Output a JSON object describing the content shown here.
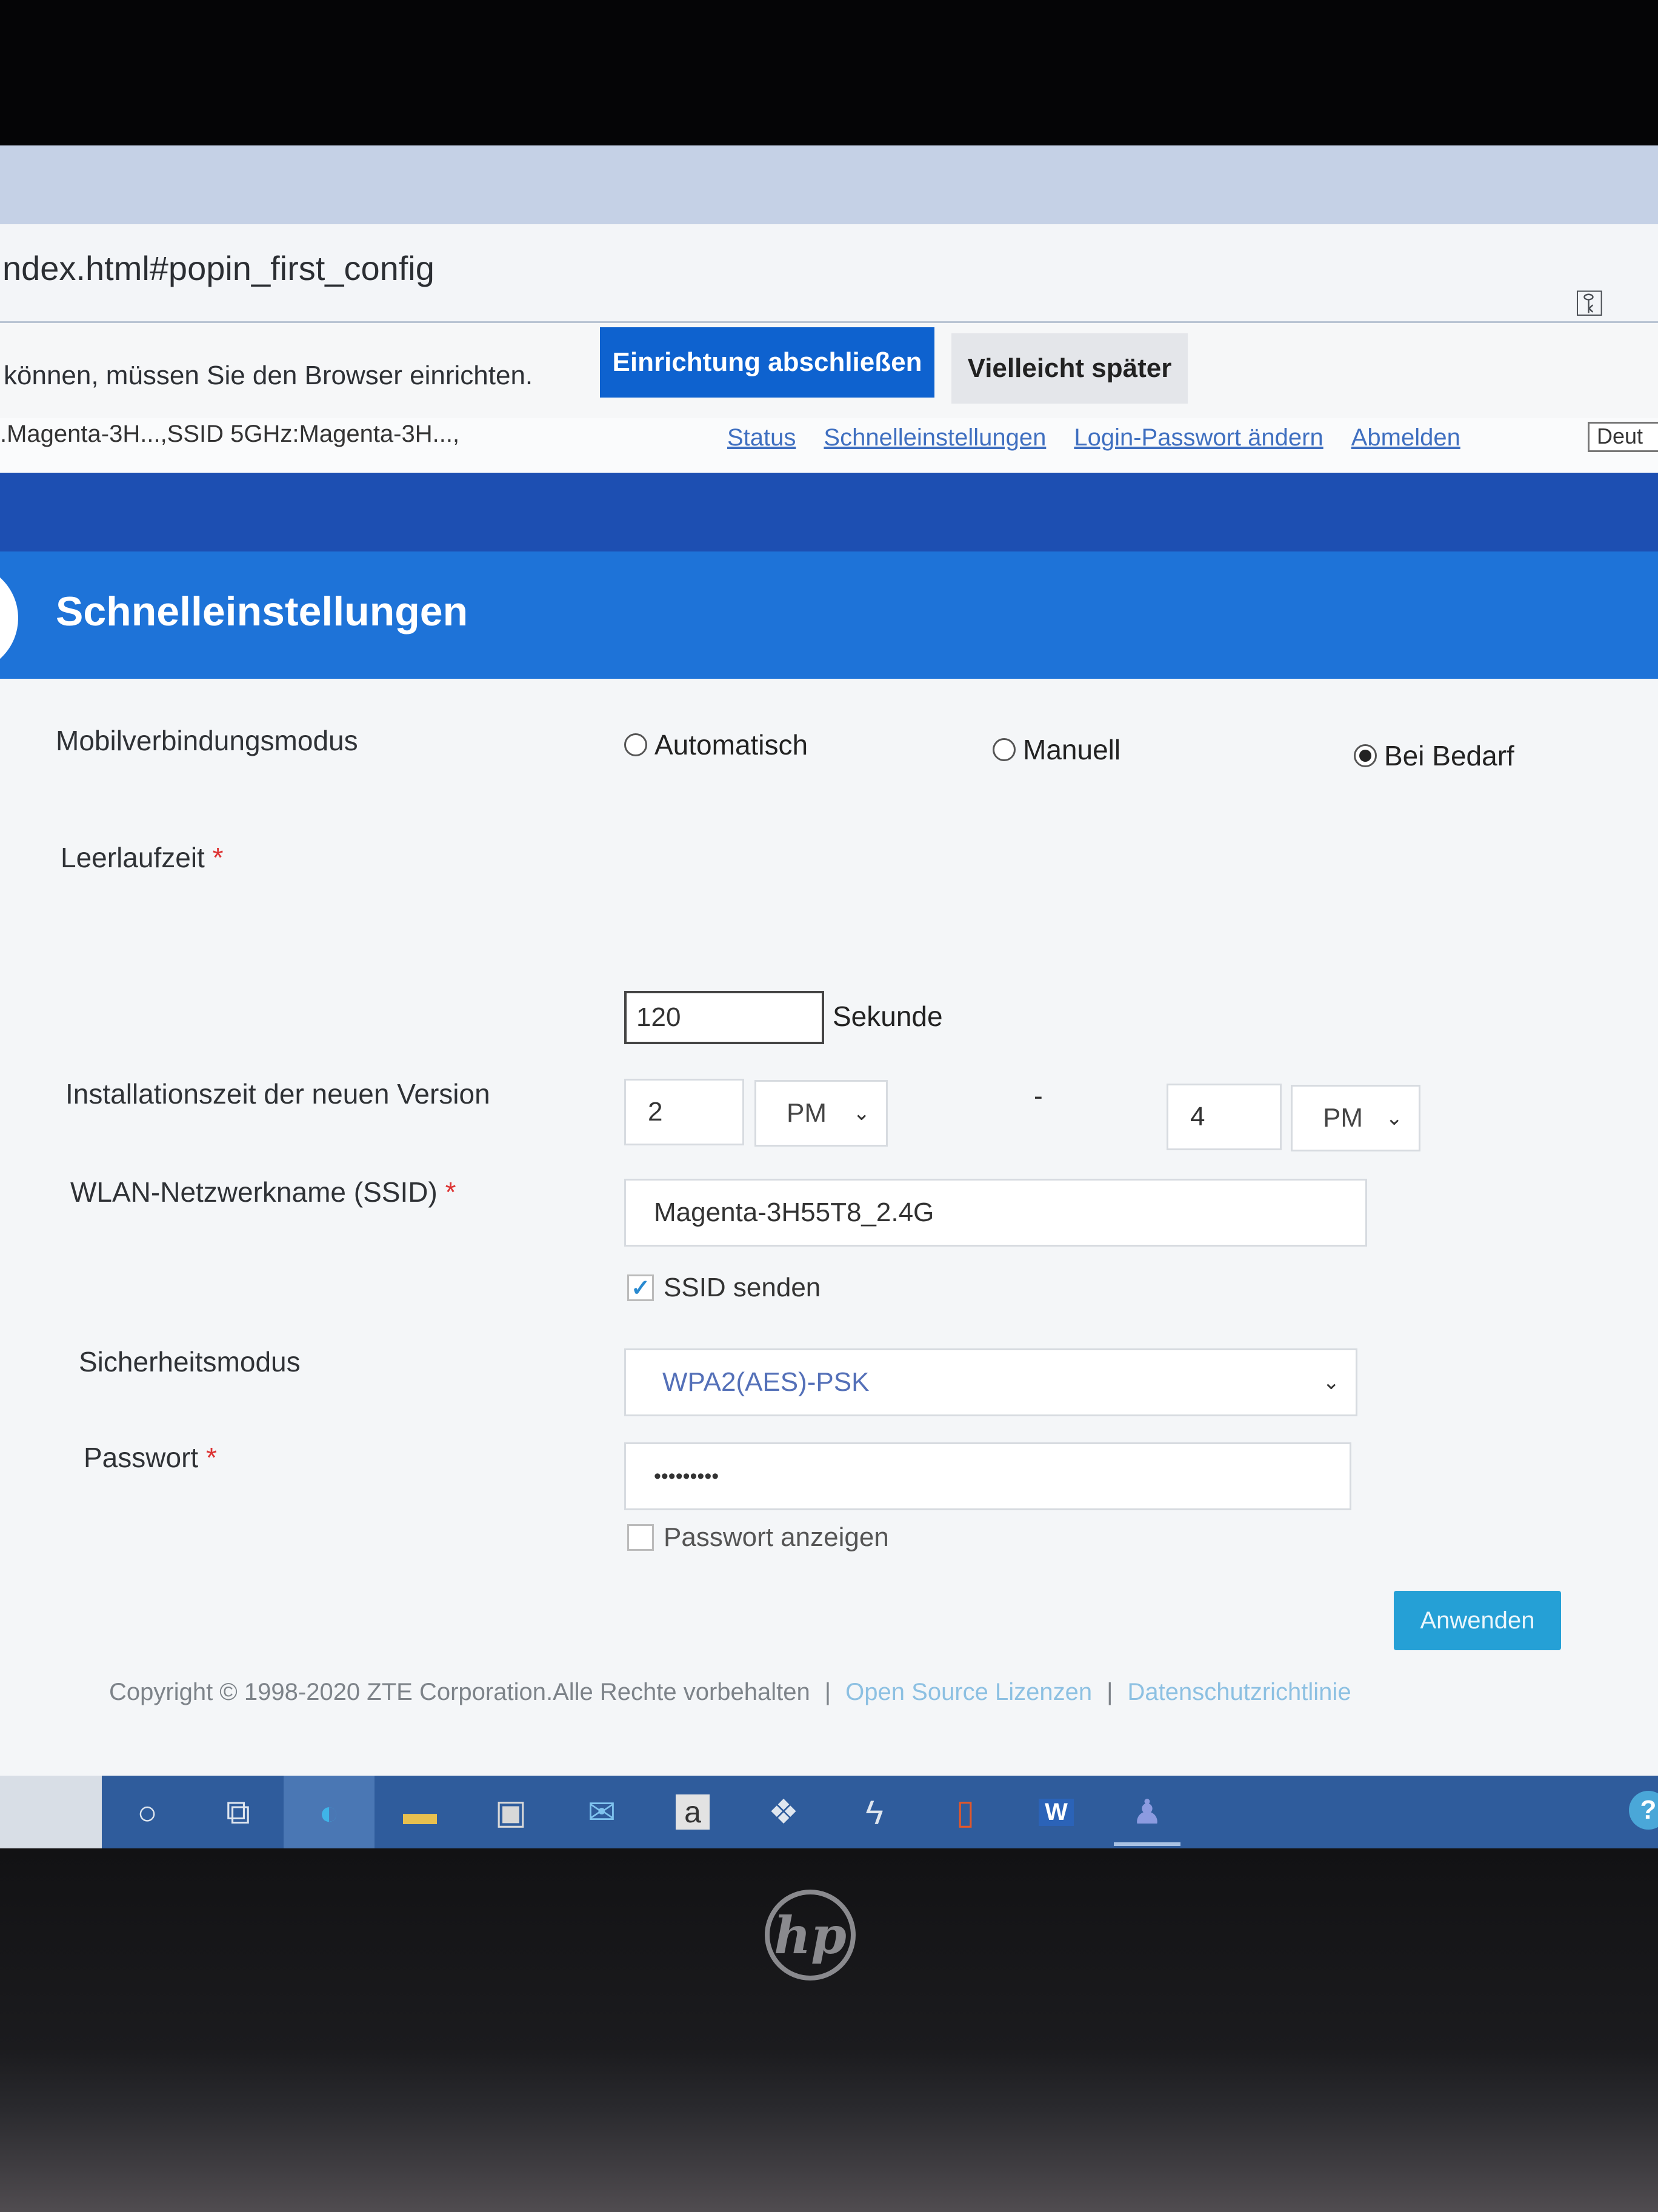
{
  "browser": {
    "url": "ndex.html#popin_first_config",
    "infobar_text": "können, müssen Sie den Browser einrichten.",
    "finish_setup_label": "Einrichtung abschließen",
    "maybe_later_label": "Vielleicht später"
  },
  "router_header": {
    "ssid_summary": ".Magenta-3H...,SSID 5GHz:Magenta-3H...,",
    "nav": [
      "Status",
      "Schnelleinstellungen",
      "Login-Passwort ändern",
      "Abmelden"
    ],
    "language": "Deut"
  },
  "page": {
    "title": "Schnelleinstellungen"
  },
  "form": {
    "mobile_mode": {
      "label": "Mobilverbindungsmodus",
      "options": [
        "Automatisch",
        "Manuell",
        "Bei Bedarf"
      ],
      "selected": "Bei Bedarf"
    },
    "idle_time": {
      "label": "Leerlaufzeit",
      "required_mark": "*",
      "value": "120",
      "unit": "Sekunde"
    },
    "install_time": {
      "label": "Installationszeit der neuen Version",
      "start_hour": "2",
      "start_period": "PM",
      "separator": "-",
      "end_hour": "4",
      "end_period": "PM"
    },
    "ssid": {
      "label": "WLAN-Netzwerkname (SSID)",
      "required_mark": "*",
      "value": "Magenta-3H55T8_2.4G",
      "broadcast_label": "SSID senden",
      "broadcast_checked": true
    },
    "security": {
      "label": "Sicherheitsmodus",
      "value": "WPA2(AES)-PSK"
    },
    "password": {
      "label": "Passwort",
      "required_mark": "*",
      "value": "•••••••••",
      "show_label": "Passwort anzeigen",
      "show_checked": false
    },
    "apply_label": "Anwenden"
  },
  "footer": {
    "copyright": "Copyright © 1998-2020 ZTE Corporation.Alle Rechte vorbehalten",
    "separator": "|",
    "open_source": "Open Source Lizenzen",
    "privacy": "Datenschutzrichtlinie"
  },
  "taskbar": {
    "store_letter": "a",
    "word_letter": "W",
    "help_symbol": "?"
  },
  "laptop": {
    "brand": "hp"
  }
}
